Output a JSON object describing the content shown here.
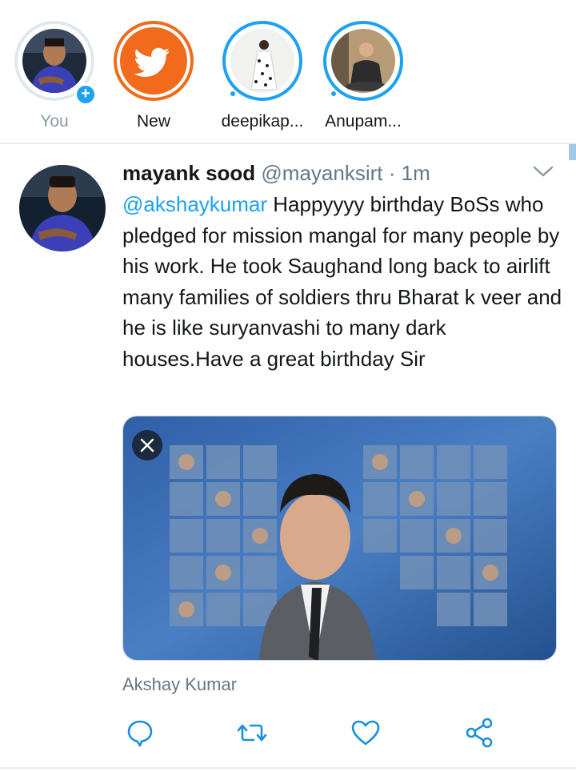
{
  "fleets": [
    {
      "label": "You",
      "has_add": true
    },
    {
      "label": "New"
    },
    {
      "label": "deepikap..."
    },
    {
      "label": "Anupam..."
    }
  ],
  "tweet": {
    "display_name": "mayank sood",
    "handle": "@mayanksirt",
    "separator": "·",
    "time": "1m",
    "mention": "@akshaykumar",
    "text": "Happyyyy birthday BoSs who pledged for mission mangal for many people by his work. He took Saughand long back to airlift many families of soldiers thru Bharat k veer and he is like suryanvashi to many dark houses.Have a great birthday Sir",
    "media_caption": "Akshay Kumar"
  },
  "icons": {
    "menu": "chevron-down-icon",
    "reply": "reply-icon",
    "retweet": "retweet-icon",
    "like": "like-icon",
    "share": "share-icon",
    "close": "close-icon",
    "twitter": "twitter-bird-icon",
    "add": "plus-icon"
  },
  "colors": {
    "accent": "#1da1f2",
    "text": "#14171a",
    "muted": "#657786",
    "new_fleet": "#f26a1b",
    "action_icon": "#1a91da"
  }
}
